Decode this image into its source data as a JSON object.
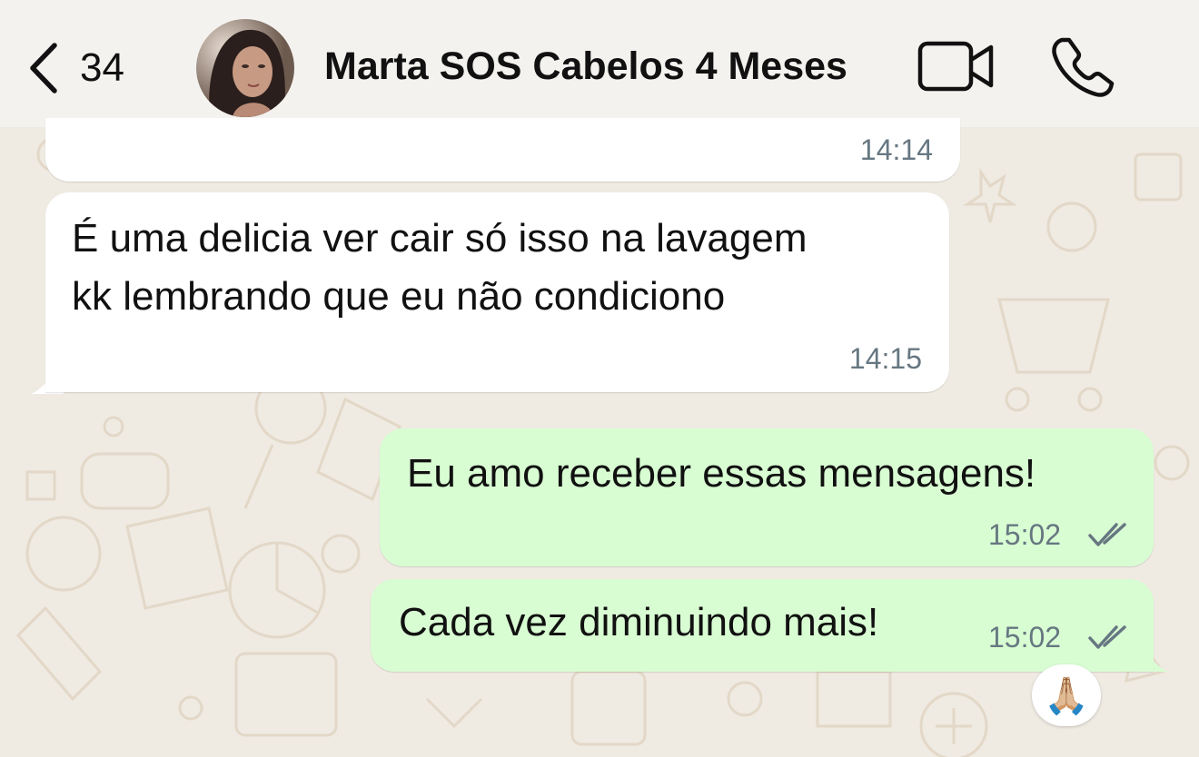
{
  "header": {
    "back_count": "34",
    "contact_name": "Marta SOS Cabelos 4 Meses",
    "icons": {
      "back": "chevron-left-icon",
      "video": "video-camera-icon",
      "call": "phone-icon"
    }
  },
  "messages": [
    {
      "direction": "incoming",
      "text": "",
      "time": "14:14"
    },
    {
      "direction": "incoming",
      "text_lines": [
        "É uma delicia ver cair só isso na lavagem",
        "kk lembrando que eu não condiciono"
      ],
      "time": "14:15"
    },
    {
      "direction": "outgoing",
      "text": "Eu amo receber essas mensagens!",
      "time": "15:02",
      "status": "read"
    },
    {
      "direction": "outgoing",
      "text": "Cada vez diminuindo mais!",
      "time": "15:02",
      "status": "read",
      "reaction": "🙏🏼"
    }
  ],
  "colors": {
    "incoming_bubble": "#ffffff",
    "outgoing_bubble": "#d9fdd3",
    "wallpaper": "#efeae2",
    "read_ticks": "#667781"
  }
}
